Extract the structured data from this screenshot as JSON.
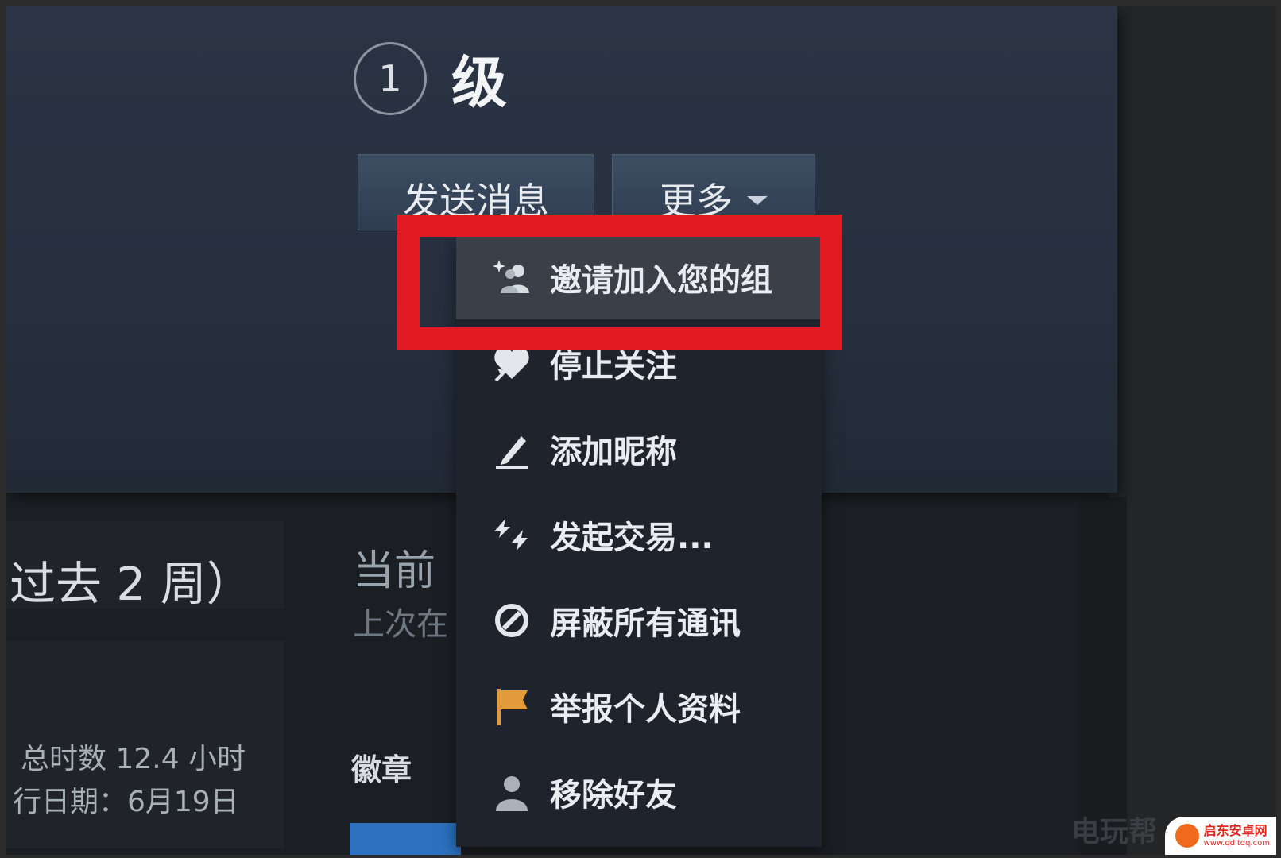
{
  "profile": {
    "level_number": "1",
    "level_label": "级",
    "send_message_label": "发送消息",
    "more_label": "更多"
  },
  "menu": {
    "items": [
      {
        "label": "邀请加入您的组",
        "icon": "invite-group-icon"
      },
      {
        "label": "停止关注",
        "icon": "heart-icon"
      },
      {
        "label": "添加昵称",
        "icon": "pencil-icon"
      },
      {
        "label": "发起交易...",
        "icon": "trade-arrows-icon"
      },
      {
        "label": "屏蔽所有通讯",
        "icon": "block-icon"
      },
      {
        "label": "举报个人资料",
        "icon": "flag-icon"
      },
      {
        "label": "移除好友",
        "icon": "person-icon"
      }
    ]
  },
  "content": {
    "recent_activity_label": "过去 2 周）",
    "current_label": "当前",
    "last_online_label": "上次在",
    "total_hours": "总时数 12.4 小时",
    "release_date": "行日期：6月19日",
    "badges_label": "徽章"
  },
  "watermark": {
    "title": "启东安卓网",
    "url": "www.qdltdq.com",
    "ghost_text": "电玩帮"
  },
  "colors": {
    "highlight_border": "#e21a24",
    "flag": "#e39a3b"
  }
}
